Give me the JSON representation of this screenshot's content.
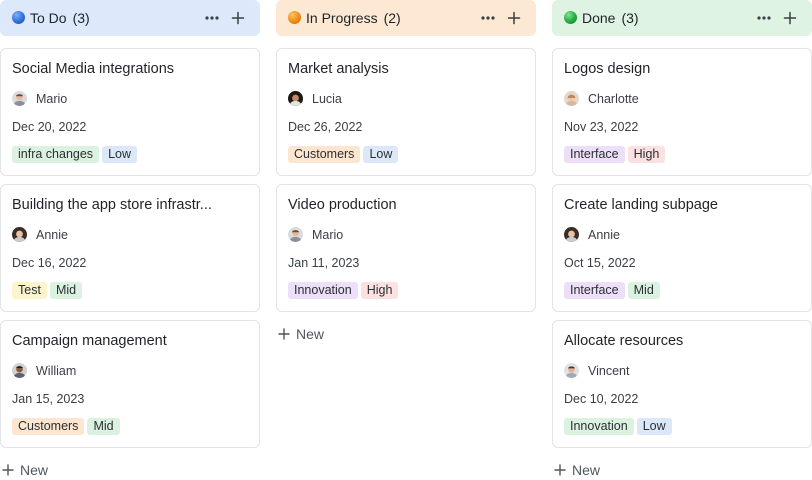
{
  "colors": {
    "todo_header": "#dde9fb",
    "inprogress_header": "#fde8d3",
    "done_header": "#dff3e3",
    "todo_dot": "#2f6fd6",
    "inprogress_dot": "#f08a12",
    "done_dot": "#25a842",
    "tag_green": "#dcf2e1",
    "tag_blue": "#dce7f8",
    "tag_yellow": "#fbf4cc",
    "tag_orange": "#fde6cf",
    "tag_red": "#fbe1e1",
    "tag_purple": "#ecdff7",
    "card_border": "#e1e3e6"
  },
  "icons": {
    "more": "more-horizontal-icon",
    "add": "plus-icon",
    "status_dot": "status-circle-icon",
    "avatar": "user-avatar-icon"
  },
  "board": {
    "new_label": "New",
    "columns": [
      {
        "title": "To Do",
        "count": "(3)",
        "cards": [
          {
            "title": "Social Media integrations",
            "assignee": "Mario",
            "date": "Dec 20, 2022",
            "tags": [
              {
                "label": "infra changes",
                "color": "green"
              },
              {
                "label": "Low",
                "color": "blue"
              }
            ]
          },
          {
            "title": "Building the app store infrastr...",
            "assignee": "Annie",
            "date": "Dec 16, 2022",
            "tags": [
              {
                "label": "Test",
                "color": "yellow"
              },
              {
                "label": "Mid",
                "color": "green"
              }
            ]
          },
          {
            "title": "Campaign management",
            "assignee": "William",
            "date": "Jan 15, 2023",
            "tags": [
              {
                "label": "Customers",
                "color": "orange"
              },
              {
                "label": "Mid",
                "color": "green"
              }
            ]
          }
        ]
      },
      {
        "title": "In Progress",
        "count": "(2)",
        "cards": [
          {
            "title": "Market analysis",
            "assignee": "Lucia",
            "date": "Dec 26, 2022",
            "tags": [
              {
                "label": "Customers",
                "color": "orange"
              },
              {
                "label": "Low",
                "color": "blue"
              }
            ]
          },
          {
            "title": "Video production",
            "assignee": "Mario",
            "date": "Jan 11, 2023",
            "tags": [
              {
                "label": "Innovation",
                "color": "purple"
              },
              {
                "label": "High",
                "color": "red"
              }
            ]
          }
        ]
      },
      {
        "title": "Done",
        "count": "(3)",
        "cards": [
          {
            "title": "Logos design",
            "assignee": "Charlotte",
            "date": "Nov 23, 2022",
            "tags": [
              {
                "label": "Interface",
                "color": "purple"
              },
              {
                "label": "High",
                "color": "red"
              }
            ]
          },
          {
            "title": "Create landing subpage",
            "assignee": "Annie",
            "date": "Oct 15, 2022",
            "tags": [
              {
                "label": "Interface",
                "color": "purple"
              },
              {
                "label": "Mid",
                "color": "green"
              }
            ]
          },
          {
            "title": "Allocate resources",
            "assignee": "Vincent",
            "date": "Dec 10, 2022",
            "tags": [
              {
                "label": "Innovation",
                "color": "green"
              },
              {
                "label": "Low",
                "color": "blue"
              }
            ]
          }
        ]
      }
    ]
  }
}
